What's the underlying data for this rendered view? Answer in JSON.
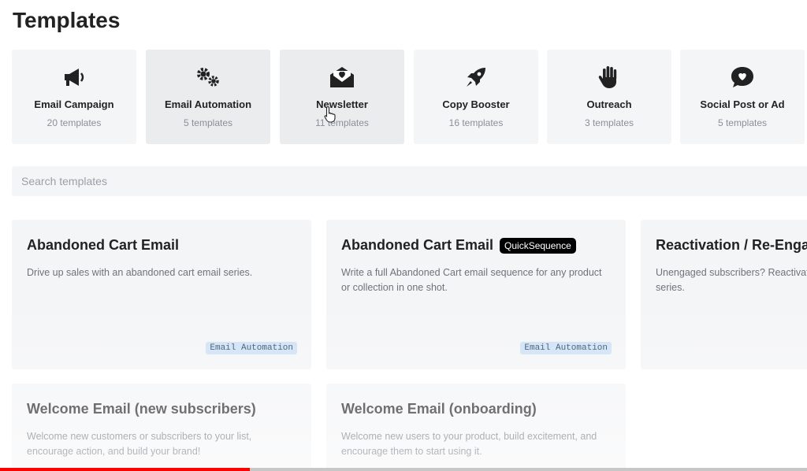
{
  "page": {
    "title": "Templates"
  },
  "categories": [
    {
      "name": "Email Campaign",
      "count": "20 templates",
      "icon": "megaphone-icon"
    },
    {
      "name": "Email Automation",
      "count": "5 templates",
      "icon": "gears-icon"
    },
    {
      "name": "Newsletter",
      "count": "11 templates",
      "icon": "envelope-heart-icon"
    },
    {
      "name": "Copy Booster",
      "count": "16 templates",
      "icon": "rocket-icon"
    },
    {
      "name": "Outreach",
      "count": "3 templates",
      "icon": "hand-icon"
    },
    {
      "name": "Social Post or Ad",
      "count": "5 templates",
      "icon": "comment-heart-icon"
    }
  ],
  "search": {
    "placeholder": "Search templates",
    "value": ""
  },
  "templates": [
    {
      "title": "Abandoned Cart Email",
      "badge": "",
      "description": "Drive up sales with an abandoned cart email series.",
      "tag": "Email Automation"
    },
    {
      "title": "Abandoned Cart Email",
      "badge": "QuickSequence",
      "description": "Write a full Abandoned Cart email sequence for any product or collection in one shot.",
      "tag": "Email Automation"
    },
    {
      "title": "Reactivation / Re-Engagement",
      "badge": "",
      "description": "Unengaged subscribers? Reactivate them with an email series.",
      "tag": ""
    },
    {
      "title": "Welcome Email (new subscribers)",
      "badge": "",
      "description": "Welcome new customers or subscribers to your list, encourage action, and build your brand!",
      "tag": ""
    },
    {
      "title": "Welcome Email (onboarding)",
      "badge": "",
      "description": "Welcome new users to your product, build excitement, and encourage them to start using it.",
      "tag": ""
    }
  ],
  "video": {
    "progress": 0.31
  },
  "colors": {
    "card_bg": "#f4f5f7",
    "tag_bg": "#cfe1f5",
    "badge_bg": "#000000",
    "progress": "#ff0000"
  }
}
